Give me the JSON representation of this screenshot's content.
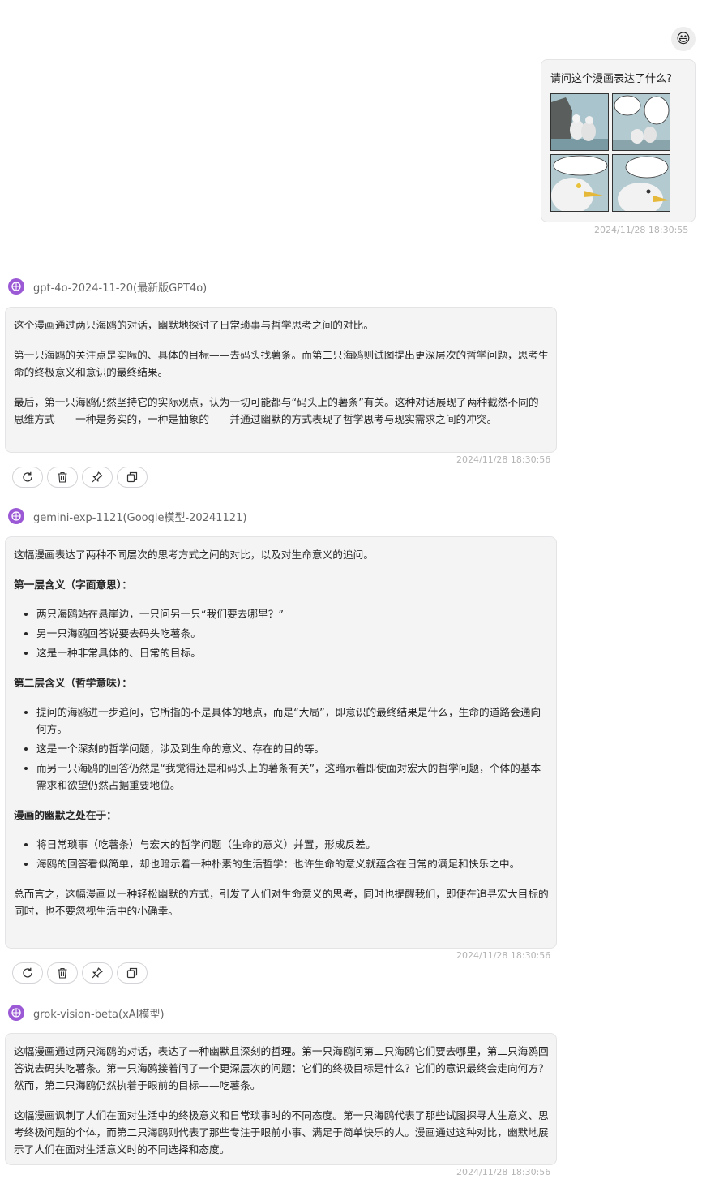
{
  "user_message": {
    "avatar": "😃",
    "text": "请问这个漫画表达了什么?",
    "image_name": "seagull-comic-image",
    "timestamp": "2024/11/28 18:30:55"
  },
  "responses": [
    {
      "model": "gpt-4o-2024-11-20(最新版GPT4o)",
      "paragraphs": [
        "这个漫画通过两只海鸥的对话，幽默地探讨了日常琐事与哲学思考之间的对比。",
        "第一只海鸥的关注点是实际的、具体的目标——去码头找薯条。而第二只海鸥则试图提出更深层次的哲学问题，思考生命的终极意义和意识的最终结果。",
        "最后，第一只海鸥仍然坚持它的实际观点，认为一切可能都与“码头上的薯条”有关。这种对话展现了两种截然不同的思维方式——一种是务实的，一种是抽象的——并通过幽默的方式表现了哲学思考与现实需求之间的冲突。"
      ],
      "timestamp": "2024/11/28 18:30:56"
    },
    {
      "model": "gemini-exp-1121(Google模型-20241121)",
      "intro": "这幅漫画表达了两种不同层次的思考方式之间的对比，以及对生命意义的追问。",
      "section1_title": "第一层含义（字面意思）：",
      "section1_items": [
        "两只海鸥站在悬崖边，一只问另一只“我们要去哪里？”",
        "另一只海鸥回答说要去码头吃薯条。",
        "这是一种非常具体的、日常的目标。"
      ],
      "section2_title": "第二层含义（哲学意味）：",
      "section2_items": [
        "提问的海鸥进一步追问，它所指的不是具体的地点，而是“大局”，即意识的最终结果是什么，生命的道路会通向何方。",
        "这是一个深刻的哲学问题，涉及到生命的意义、存在的目的等。",
        "而另一只海鸥的回答仍然是“我觉得还是和码头上的薯条有关”，这暗示着即使面对宏大的哲学问题，个体的基本需求和欲望仍然占据重要地位。"
      ],
      "section3_title": "漫画的幽默之处在于：",
      "section3_items": [
        "将日常琐事（吃薯条）与宏大的哲学问题（生命的意义）并置，形成反差。",
        "海鸥的回答看似简单，却也暗示着一种朴素的生活哲学：也许生命的意义就蕴含在日常的满足和快乐之中。"
      ],
      "conclusion": "总而言之，这幅漫画以一种轻松幽默的方式，引发了人们对生命意义的思考，同时也提醒我们，即使在追寻宏大目标的同时，也不要忽视生活中的小确幸。",
      "timestamp": "2024/11/28 18:30:56"
    },
    {
      "model": "grok-vision-beta(xAI模型)",
      "paragraphs": [
        "这幅漫画通过两只海鸥的对话，表达了一种幽默且深刻的哲理。第一只海鸥问第二只海鸥它们要去哪里，第二只海鸥回答说去码头吃薯条。第一只海鸥接着问了一个更深层次的问题：它们的终极目标是什么？它们的意识最终会走向何方？然而，第二只海鸥仍然执着于眼前的目标——吃薯条。",
        "这幅漫画讽刺了人们在面对生活中的终极意义和日常琐事时的不同态度。第一只海鸥代表了那些试图探寻人生意义、思考终极问题的个体，而第二只海鸥则代表了那些专注于眼前小事、满足于简单快乐的人。漫画通过这种对比，幽默地展示了人们在面对生活意义时的不同选择和态度。"
      ],
      "timestamp": "2024/11/28 18:30:56"
    }
  ],
  "actions": [
    "refresh-icon",
    "delete-icon",
    "pin-icon",
    "copy-icon"
  ],
  "colors": {
    "model_icon": "#9b59d6",
    "bubble_bg": "#f4f4f5",
    "timestamp": "#b4b4b4"
  }
}
